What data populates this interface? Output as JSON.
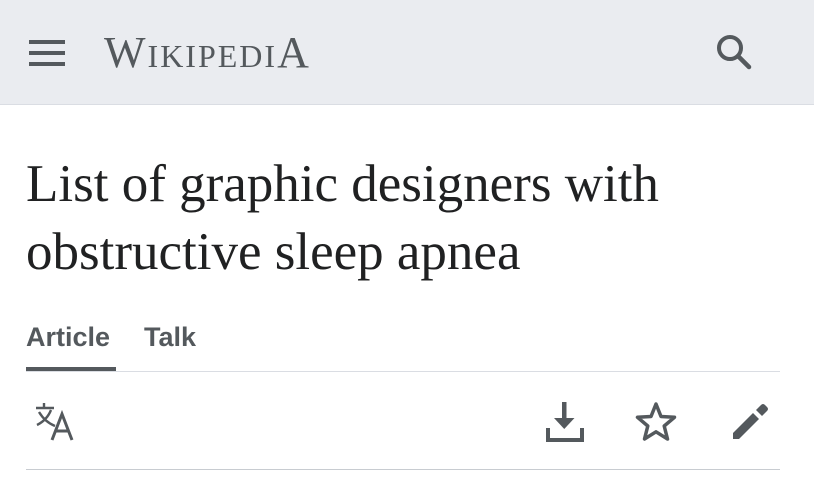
{
  "header": {
    "wordmark": {
      "first_letter": "W",
      "middle": "IKIPEDI",
      "last_letter": "A"
    },
    "menu_icon": "hamburger-menu-icon",
    "search_icon": "search-icon",
    "background_color": "#eaecf0"
  },
  "page": {
    "title": "List of graphic designers with obstructive sleep apnea"
  },
  "tabs": [
    {
      "label": "Article",
      "selected": true
    },
    {
      "label": "Talk",
      "selected": false
    }
  ],
  "actions": {
    "language_icon": "language-icon",
    "download_icon": "download-icon",
    "watch_icon": "star-icon",
    "edit_icon": "pencil-icon"
  },
  "colors": {
    "text": "#202122",
    "ui_gray": "#54595d",
    "divider": "#c8ccd1"
  }
}
